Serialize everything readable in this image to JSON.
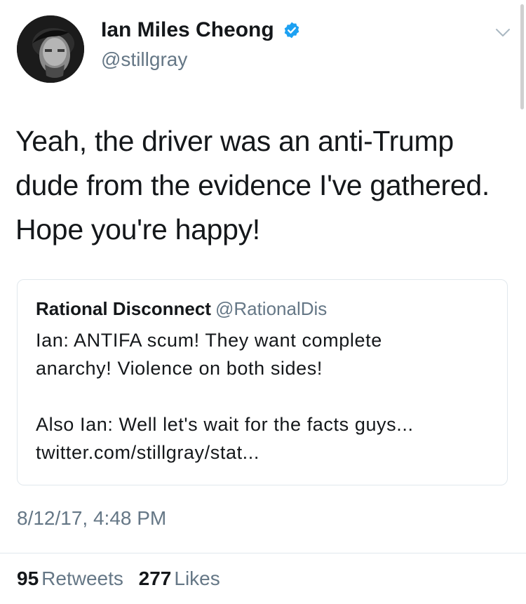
{
  "tweet": {
    "author": {
      "display_name": "Ian Miles Cheong",
      "handle": "@stillgray",
      "verified": true,
      "verified_color": "#1da1f2"
    },
    "text_lines": [
      "Yeah, the driver was an anti-Trump",
      "dude from the evidence I've gathered.",
      "Hope you're happy!"
    ],
    "quoted_tweet": {
      "display_name": "Rational Disconnect",
      "handle": "@RationalDis",
      "lines": [
        "Ian: ANTIFA scum! They want complete",
        "anarchy! Violence on both sides!",
        "",
        "Also Ian: Well let's wait for the facts guys...",
        "twitter.com/stillgray/stat..."
      ]
    },
    "timestamp": "8/12/17, 4:48 PM",
    "stats": {
      "retweets_count": "95",
      "retweets_label": "Retweets",
      "likes_count": "277",
      "likes_label": "Likes"
    },
    "icons": {
      "verified": "verified-badge-icon",
      "menu": "chevron-down-icon"
    },
    "colors": {
      "text": "#14171a",
      "secondary": "#657786",
      "border": "#e1e8ed"
    }
  }
}
